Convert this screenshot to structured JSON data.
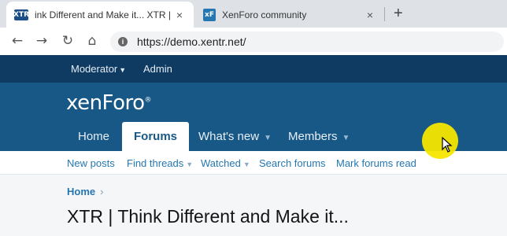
{
  "browser": {
    "tabs": [
      {
        "title": "ink Different and Make it... XTR |",
        "favicon": "XTR",
        "active": true
      },
      {
        "title": "XenForo community",
        "favicon": "xF",
        "active": false
      }
    ],
    "new_tab_icon": "+",
    "close_icon": "×",
    "url": "https://demo.xentr.net/"
  },
  "staffbar": {
    "moderator": "Moderator",
    "admin": "Admin"
  },
  "header": {
    "logo": "xenForo",
    "logo_mark": "®"
  },
  "nav": {
    "tabs": [
      {
        "label": "Home"
      },
      {
        "label": "Forums"
      },
      {
        "label": "What's new"
      },
      {
        "label": "Members"
      }
    ]
  },
  "subnav": {
    "items": [
      {
        "label": "New posts"
      },
      {
        "label": "Find threads"
      },
      {
        "label": "Watched"
      },
      {
        "label": "Search forums"
      },
      {
        "label": "Mark forums read"
      }
    ]
  },
  "breadcrumb": {
    "home": "Home",
    "separator": "›"
  },
  "page": {
    "title": "XTR | Think Different and Make it..."
  },
  "colors": {
    "staffbar": "#0f3a62",
    "header": "#185886",
    "link": "#2577b1",
    "cursor_highlight": "#f5e600"
  }
}
